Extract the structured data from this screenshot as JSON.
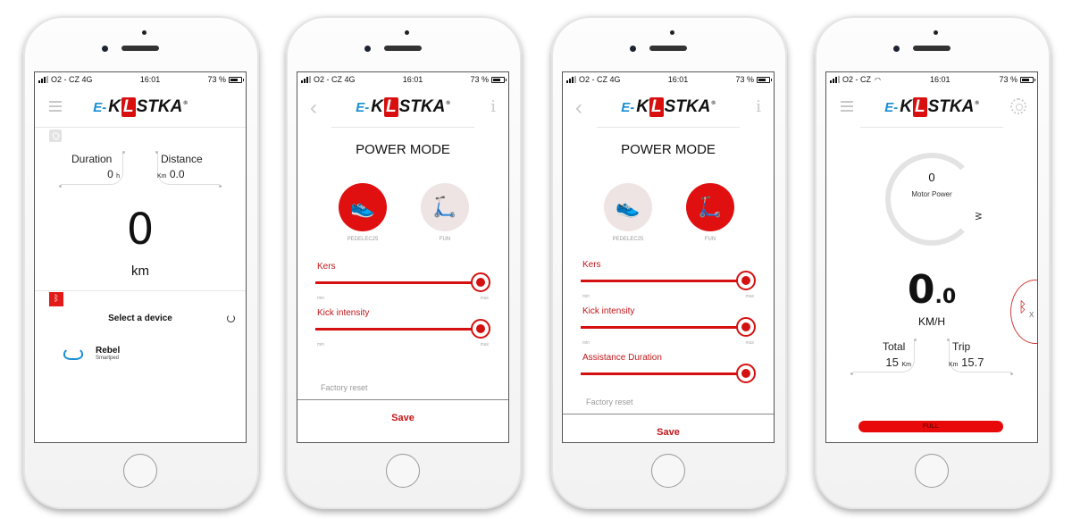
{
  "brand": {
    "prefix": "E-",
    "name_a": "K",
    "name_o": "L",
    "name_b": "STKA",
    "registered": "®",
    "accent_red": "#e01010",
    "accent_blue": "#1a8fd1"
  },
  "screens": [
    {
      "status": {
        "carrier": "O2 - CZ 4G",
        "time": "16:01",
        "battery": "73 %"
      },
      "stats": {
        "duration_label": "Duration",
        "duration_value": "0",
        "duration_unit": "h",
        "distance_label": "Distance",
        "distance_unit": "Km",
        "distance_value": "0.0"
      },
      "big_value": "0",
      "big_unit": "km",
      "select_device": "Select a device",
      "device": {
        "name": "Rebel",
        "type": "Smartped"
      }
    },
    {
      "status": {
        "carrier": "O2 - CZ 4G",
        "time": "16:01",
        "battery": "73 %"
      },
      "title": "POWER MODE",
      "modes": [
        {
          "label": "PEDELEC25",
          "active": true
        },
        {
          "label": "FUN",
          "active": false
        }
      ],
      "sliders": [
        {
          "label": "Kers",
          "value": 1.0,
          "min": "min",
          "max": "max"
        },
        {
          "label": "Kick intensity",
          "value": 1.0,
          "min": "min",
          "max": "max"
        }
      ],
      "factory_reset": "Factory reset",
      "save": "Save"
    },
    {
      "status": {
        "carrier": "O2 - CZ 4G",
        "time": "16:01",
        "battery": "73 %"
      },
      "title": "POWER MODE",
      "modes": [
        {
          "label": "PEDELEC25",
          "active": false
        },
        {
          "label": "FUN",
          "active": true
        }
      ],
      "sliders": [
        {
          "label": "Kers",
          "value": 1.0,
          "min": "min",
          "max": "max"
        },
        {
          "label": "Kick intensity",
          "value": 1.0,
          "min": "min",
          "max": "max"
        },
        {
          "label": "Assistance Duration",
          "value": 1.0
        }
      ],
      "factory_reset": "Factory reset",
      "save": "Save"
    },
    {
      "status": {
        "carrier": "O2 - CZ",
        "time": "16:01",
        "battery": "73 %"
      },
      "motor_power_value": "0",
      "motor_power_label": "Motor Power",
      "motor_power_unit": "W",
      "speed_int": "0",
      "speed_dec": ".0",
      "speed_unit": "KM/H",
      "total_label": "Total",
      "total_value": "15",
      "total_unit": "Km",
      "trip_label": "Trip",
      "trip_value": "15.7",
      "trip_unit": "Km",
      "battery_state": "FULL",
      "bt_x": "X"
    }
  ]
}
